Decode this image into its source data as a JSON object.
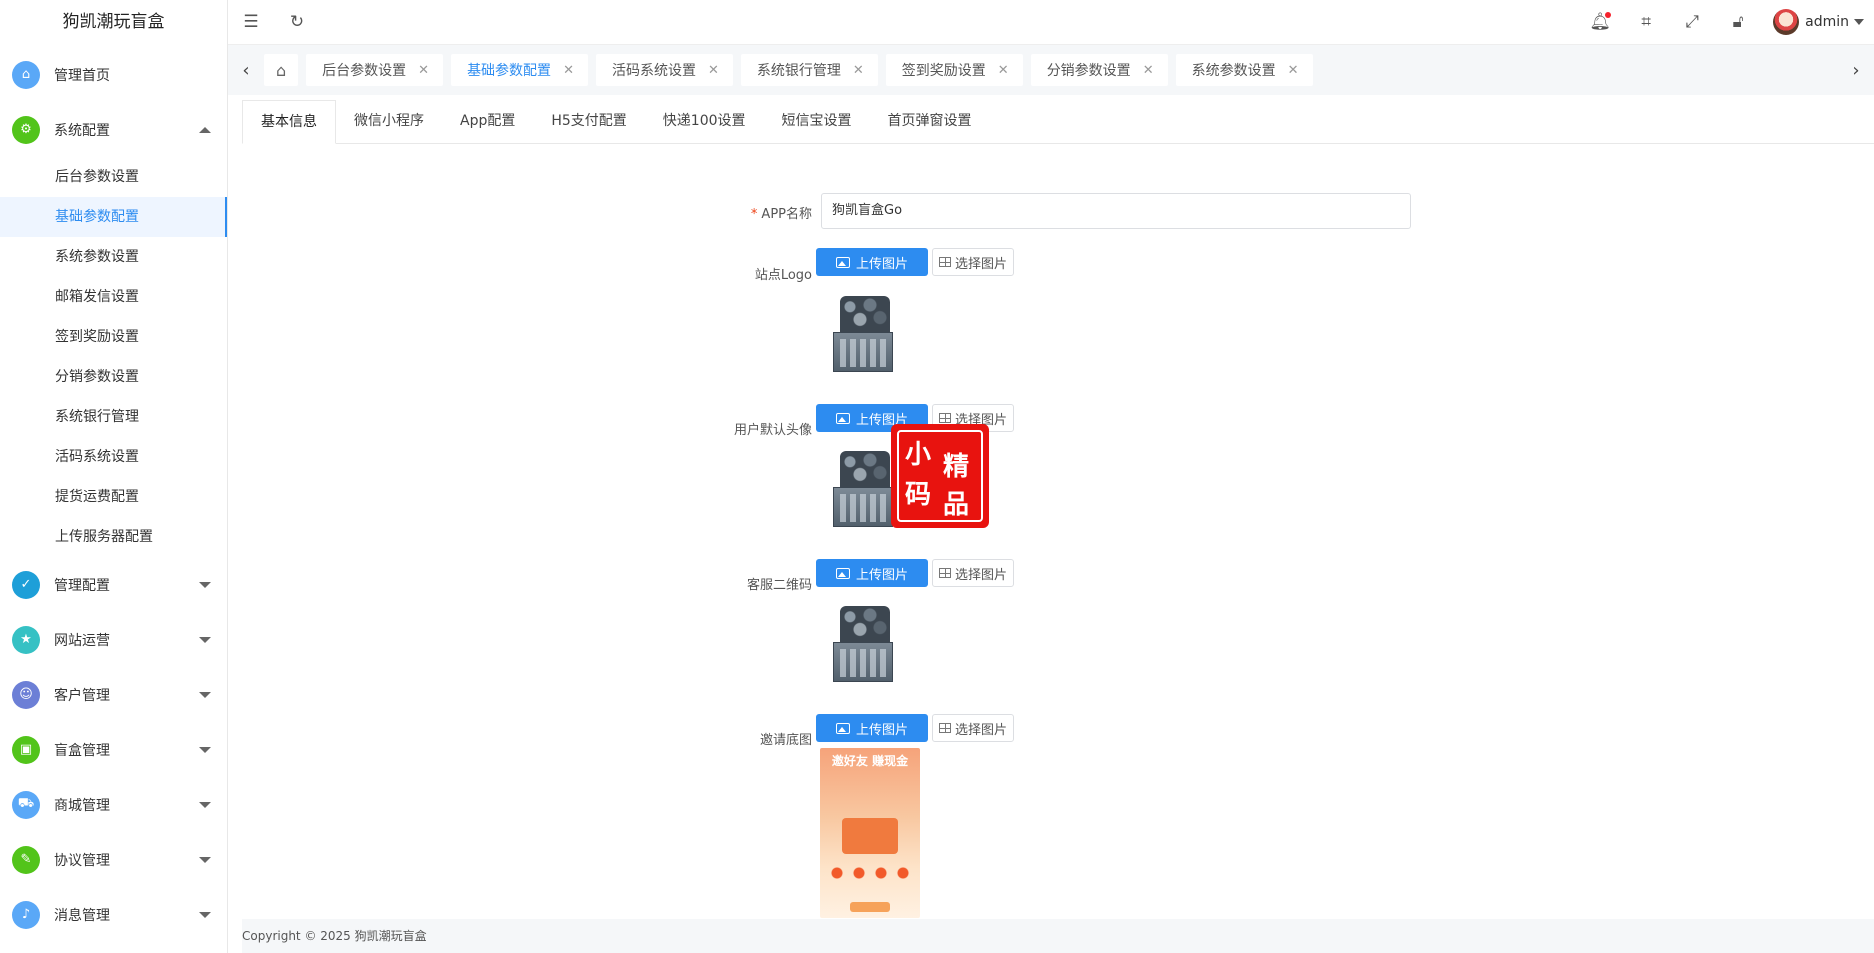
{
  "app": {
    "title": "狗凯潮玩盲盒"
  },
  "sidebar": {
    "items": [
      {
        "label": "管理首页",
        "icon": "home-icon",
        "color": "#5aa8f7"
      },
      {
        "label": "系统配置",
        "icon": "gear-icon",
        "color": "#52c41a",
        "expanded": true,
        "children": [
          "后台参数设置",
          "基础参数配置",
          "系统参数设置",
          "邮箱发信设置",
          "签到奖励设置",
          "分销参数设置",
          "系统银行管理",
          "活码系统设置",
          "提货运费配置",
          "上传服务器配置"
        ],
        "active_child": "基础参数配置"
      },
      {
        "label": "管理配置",
        "icon": "shield-icon",
        "color": "#1e9fd8"
      },
      {
        "label": "网站运营",
        "icon": "star-icon",
        "color": "#36c1c4"
      },
      {
        "label": "客户管理",
        "icon": "user-icon",
        "color": "#6c7fd6"
      },
      {
        "label": "盲盒管理",
        "icon": "gift-icon",
        "color": "#52c41a"
      },
      {
        "label": "商城管理",
        "icon": "cart-icon",
        "color": "#5aa8f7"
      },
      {
        "label": "协议管理",
        "icon": "document-icon",
        "color": "#52c41a"
      },
      {
        "label": "消息管理",
        "icon": "bell-icon",
        "color": "#5aa8f7"
      }
    ]
  },
  "header": {
    "user": "admin",
    "icons": [
      "menu-fold-icon",
      "refresh-icon",
      "bell-icon",
      "tag-icon",
      "fullscreen-icon",
      "lock-icon"
    ]
  },
  "tabs": {
    "items": [
      "后台参数设置",
      "基础参数配置",
      "活码系统设置",
      "系统银行管理",
      "签到奖励设置",
      "分销参数设置",
      "系统参数设置"
    ],
    "active": "基础参数配置"
  },
  "subtabs": {
    "items": [
      "基本信息",
      "微信小程序",
      "App配置",
      "H5支付配置",
      "快递100设置",
      "短信宝设置",
      "首页弹窗设置"
    ],
    "active": "基本信息"
  },
  "form": {
    "app_name_label": "APP名称",
    "app_name_value": "狗凯盲盒Go",
    "site_logo_label": "站点Logo",
    "default_avatar_label": "用户默认头像",
    "service_qr_label": "客服二维码",
    "invite_bg_label": "邀请底图",
    "upload_label": "上传图片",
    "select_label": "选择图片",
    "poster_title": "邀好友  赚现金"
  },
  "stamp": {
    "chars": [
      "小",
      "精",
      "码",
      "品"
    ]
  },
  "footer": {
    "copyright": "Copyright © 2025 狗凯潮玩盲盒"
  }
}
